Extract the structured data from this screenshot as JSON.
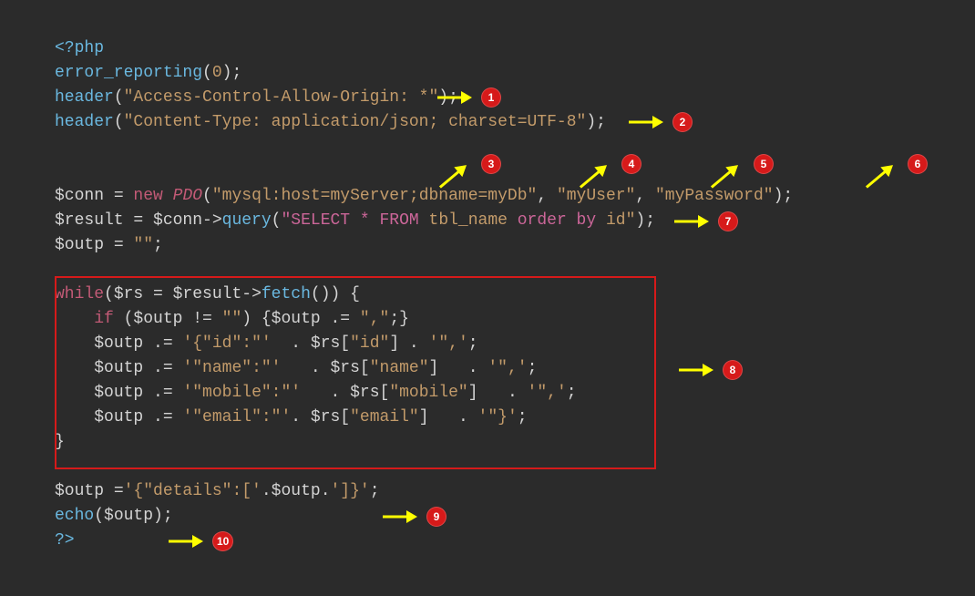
{
  "code": {
    "l1": "<?php",
    "l2a": "error_reporting",
    "l2b": "(",
    "l2c": "0",
    "l2d": ");",
    "l3a": "header",
    "l3b": "(",
    "l3c": "\"Access-Control-Allow-Origin: *\"",
    "l3d": ");",
    "l4a": "header",
    "l4b": "(",
    "l4c": "\"Content-Type: application/json; charset=UTF-8\"",
    "l4d": ");",
    "l5a": "$conn",
    "l5b": " = ",
    "l5c": "new",
    "l5d": " ",
    "l5e": "PDO",
    "l5f": "(",
    "l5g": "\"mysql:host=myServer;dbname=myDb\"",
    "l5h": ", ",
    "l5i": "\"myUser\"",
    "l5j": ", ",
    "l5k": "\"myPassword\"",
    "l5l": ");",
    "l6a": "$result",
    "l6b": " = ",
    "l6c": "$conn",
    "l6d": "->",
    "l6e": "query",
    "l6f": "(",
    "l6g": "\"SELECT * FROM",
    "l6h": " tbl_name ",
    "l6i": "order by",
    "l6j": " id",
    "l6k": "\"",
    "l6l": ");",
    "l7a": "$outp",
    "l7b": " = ",
    "l7c": "\"\"",
    "l7d": ";",
    "l8a": "while",
    "l8b": "(",
    "l8c": "$rs",
    "l8d": " = ",
    "l8e": "$result",
    "l8f": "->",
    "l8g": "fetch",
    "l8h": "()) {",
    "l9a": "    if",
    "l9b": " (",
    "l9c": "$outp",
    "l9d": " != ",
    "l9e": "\"\"",
    "l9f": ") {",
    "l9g": "$outp",
    "l9h": " .= ",
    "l9i": "\",\"",
    "l9j": ";}",
    "l10a": "    ",
    "l10b": "$outp",
    "l10c": " .= ",
    "l10d": "'{\"id\":\"'",
    "l10e": "  . ",
    "l10f": "$rs",
    "l10g": "[",
    "l10h": "\"id\"",
    "l10i": "] . ",
    "l10j": "'\",'",
    "l10k": ";",
    "l11a": "    ",
    "l11b": "$outp",
    "l11c": " .= ",
    "l11d": "'\"name\":\"'",
    "l11e": "   . ",
    "l11f": "$rs",
    "l11g": "[",
    "l11h": "\"name\"",
    "l11i": "]   . ",
    "l11j": "'\",'",
    "l11k": ";",
    "l12a": "    ",
    "l12b": "$outp",
    "l12c": " .= ",
    "l12d": "'\"mobile\":\"'",
    "l12e": "   . ",
    "l12f": "$rs",
    "l12g": "[",
    "l12h": "\"mobile\"",
    "l12i": "]   . ",
    "l12j": "'\",'",
    "l12k": ";",
    "l13a": "    ",
    "l13b": "$outp",
    "l13c": " .= ",
    "l13d": "'\"email\":\"'",
    "l13e": ". ",
    "l13f": "$rs",
    "l13g": "[",
    "l13h": "\"email\"",
    "l13i": "]   . ",
    "l13j": "'\"}'",
    "l13k": ";",
    "l14": "}",
    "l15a": "$outp",
    "l15b": " =",
    "l15c": "'{\"details\":['",
    "l15d": ".",
    "l15e": "$outp",
    "l15f": ".",
    "l15g": "']}'",
    "l15h": ";",
    "l16a": "echo",
    "l16b": "(",
    "l16c": "$outp",
    "l16d": ");",
    "l17": "?>"
  },
  "annotations": {
    "b1": "1",
    "b2": "2",
    "b3": "3",
    "b4": "4",
    "b5": "5",
    "b6": "6",
    "b7": "7",
    "b8": "8",
    "b9": "9",
    "b10": "10"
  }
}
